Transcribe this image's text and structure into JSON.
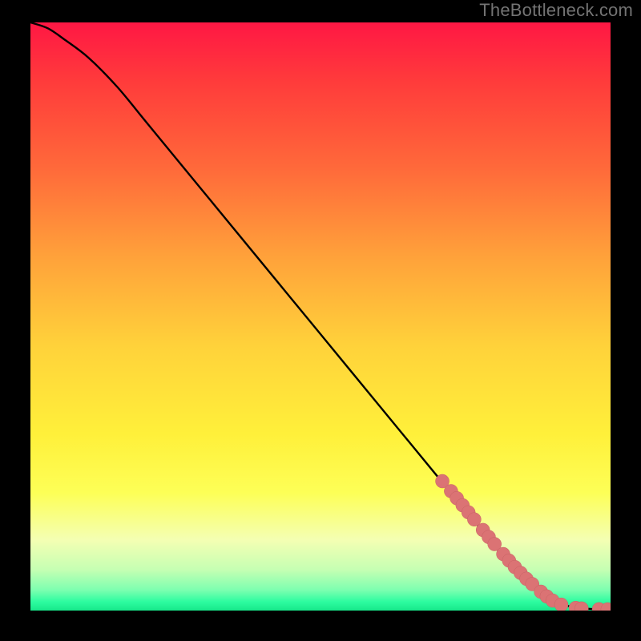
{
  "watermark": "TheBottleneck.com",
  "colors": {
    "background": "#000000",
    "watermark": "#737373",
    "curve": "#000000",
    "marker_fill": "#db7374",
    "marker_stroke": "#c76263",
    "gradient_stops": [
      {
        "offset": 0.0,
        "color": "#ff1744"
      },
      {
        "offset": 0.1,
        "color": "#ff3b3b"
      },
      {
        "offset": 0.25,
        "color": "#ff6a3a"
      },
      {
        "offset": 0.4,
        "color": "#ffa23a"
      },
      {
        "offset": 0.55,
        "color": "#ffd23a"
      },
      {
        "offset": 0.7,
        "color": "#fff03a"
      },
      {
        "offset": 0.8,
        "color": "#fdff57"
      },
      {
        "offset": 0.88,
        "color": "#f4ffb3"
      },
      {
        "offset": 0.93,
        "color": "#c6ffb3"
      },
      {
        "offset": 0.965,
        "color": "#7dffb0"
      },
      {
        "offset": 0.985,
        "color": "#2dfca0"
      },
      {
        "offset": 1.0,
        "color": "#17e88a"
      }
    ]
  },
  "chart_data": {
    "type": "line",
    "title": "",
    "xlabel": "",
    "ylabel": "",
    "xlim": [
      0,
      100
    ],
    "ylim": [
      0,
      100
    ],
    "series": [
      {
        "name": "bottleneck-curve",
        "x": [
          0,
          3,
          6,
          10,
          15,
          20,
          30,
          40,
          50,
          60,
          70,
          75,
          80,
          83,
          85,
          87,
          89,
          91,
          93,
          95,
          97,
          99,
          100
        ],
        "y": [
          100,
          99,
          97,
          94,
          89,
          83,
          71,
          59,
          47,
          35,
          23,
          17,
          11,
          7,
          5,
          3.5,
          2.2,
          1.3,
          0.7,
          0.4,
          0.25,
          0.2,
          0.2
        ]
      }
    ],
    "markers": {
      "name": "sample-points",
      "x": [
        71,
        72.5,
        73.5,
        74.5,
        75.5,
        76.5,
        78,
        79,
        80,
        81.5,
        82.5,
        83.5,
        84.5,
        85.5,
        86.5,
        88,
        89,
        90,
        91.5,
        94,
        95,
        98,
        99.5
      ],
      "y": [
        22,
        20.3,
        19.1,
        17.9,
        16.7,
        15.5,
        13.7,
        12.5,
        11.3,
        9.6,
        8.5,
        7.4,
        6.4,
        5.4,
        4.5,
        3.2,
        2.4,
        1.7,
        1.0,
        0.45,
        0.35,
        0.22,
        0.2
      ]
    }
  }
}
